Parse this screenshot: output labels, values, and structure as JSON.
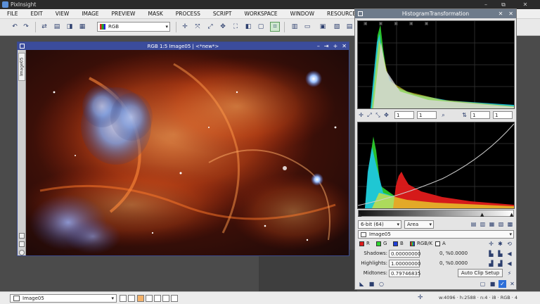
{
  "app": {
    "title": "PixInsight"
  },
  "window_controls": {
    "minimize": "–",
    "maximize": "⧉",
    "close": "✕"
  },
  "menu": [
    "FILE",
    "EDIT",
    "VIEW",
    "IMAGE",
    "PREVIEW",
    "MASK",
    "PROCESS",
    "SCRIPT",
    "WORKSPACE",
    "WINDOW",
    "RESOURCES"
  ],
  "toolbar": {
    "color_space": "RGB"
  },
  "image_window": {
    "title": "RGB 1:5 Image05 | <*new*>",
    "side_label": "Image05",
    "controls": [
      "–",
      "⇥",
      "+",
      "✕"
    ]
  },
  "histogram": {
    "title": "HistogramTransformation",
    "title_controls": [
      "✕",
      "✕"
    ],
    "upper_zoom_h": "1",
    "upper_zoom_v": "1",
    "lower_zoom_h": "1",
    "lower_zoom_v": "1",
    "bit_depth": "6-bit (64)",
    "display_mode": "Area",
    "view_target": "Image05",
    "channels": {
      "r": "R",
      "g": "G",
      "b": "B",
      "rgbk": "RGB/K",
      "a": "A"
    },
    "shadows_label": "Shadows:",
    "shadows_value": "0.00000000",
    "shadows_stats": "0, %0.0000",
    "highlights_label": "Highlights:",
    "highlights_value": "1.00000000",
    "highlights_stats": "0, %0.0000",
    "midtones_label": "Midtones:",
    "midtones_value": "0.79746835",
    "auto_clip": "Auto Clip Setup",
    "colors": {
      "red": "#e01b1b",
      "green": "#2fd42f",
      "cyan": "#1ec8e6",
      "yellow": "#e8e22a"
    }
  },
  "status": {
    "view_name": "Image05",
    "info": "w:4096 · h:2588 · n:4 · i8 · RGB · 4"
  }
}
